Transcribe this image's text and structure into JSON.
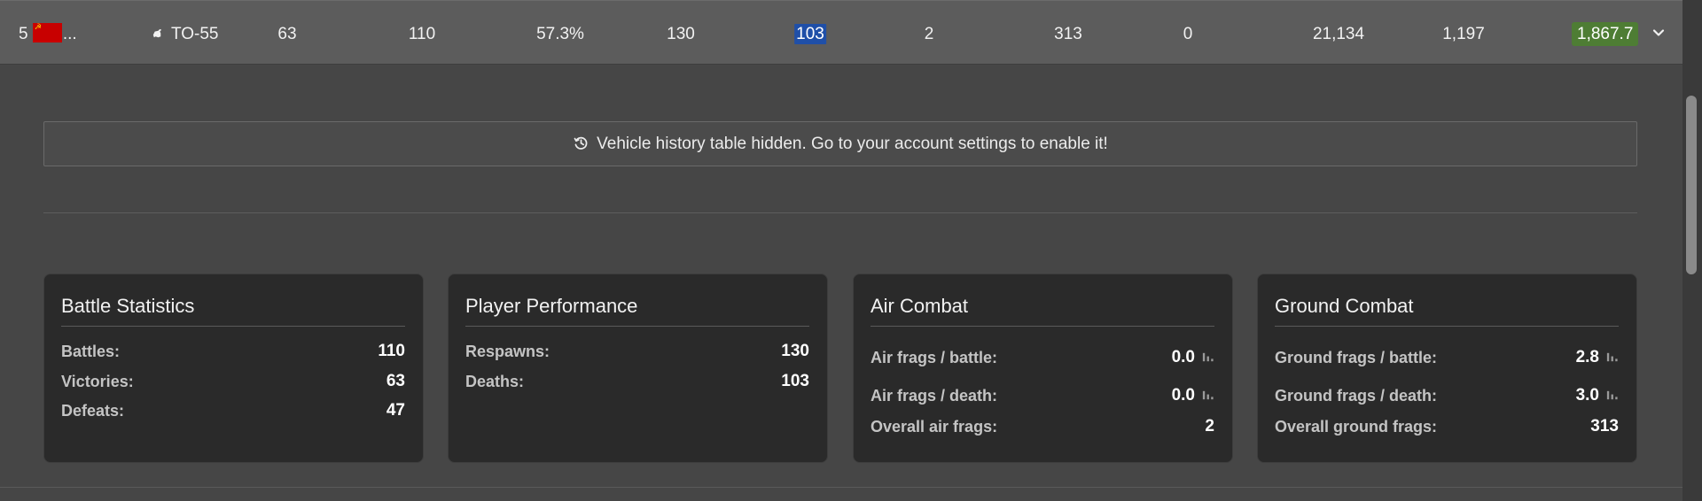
{
  "vehicle_row": {
    "rank": "5",
    "nation_ellipsis": "...",
    "vehicle_name": "TO-55",
    "col1": "63",
    "col2": "110",
    "col3": "57.3%",
    "col4": "130",
    "col5": "103",
    "col6": "2",
    "col7": "313",
    "col8": "0",
    "col9": "21,134",
    "col10": "1,197",
    "col11": "1,867.7",
    "colors": {
      "highlight_blue": "#1f4fa8",
      "highlight_green": "#4e7d34",
      "flag_red": "#c80000"
    }
  },
  "notice": {
    "icon": "history-icon",
    "text": "Vehicle history table hidden. Go to your account settings to enable it!"
  },
  "cards": {
    "battle": {
      "title": "Battle Statistics",
      "rows": [
        {
          "label": "Battles:",
          "value": "110"
        },
        {
          "label": "Victories:",
          "value": "63"
        },
        {
          "label": "Defeats:",
          "value": "47"
        }
      ]
    },
    "player": {
      "title": "Player Performance",
      "rows": [
        {
          "label": "Respawns:",
          "value": "130"
        },
        {
          "label": "Deaths:",
          "value": "103"
        }
      ]
    },
    "air": {
      "title": "Air Combat",
      "rows": [
        {
          "label": "Air frags / battle:",
          "value": "0.0"
        },
        {
          "label": "Air frags / death:",
          "value": "0.0"
        },
        {
          "label": "Overall air frags:",
          "value": "2"
        }
      ]
    },
    "ground": {
      "title": "Ground Combat",
      "rows": [
        {
          "label": "Ground frags / battle:",
          "value": "2.8"
        },
        {
          "label": "Ground frags / death:",
          "value": "3.0"
        },
        {
          "label": "Overall ground frags:",
          "value": "313"
        }
      ]
    }
  }
}
